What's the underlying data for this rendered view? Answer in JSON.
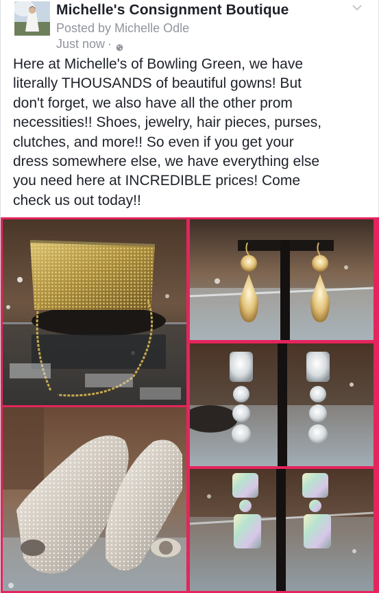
{
  "post": {
    "page_name": "Michelle's Consignment Boutique",
    "posted_by": "Posted by Michelle Odle",
    "timestamp": "Just now",
    "separator": "·",
    "message_lines": [
      "Here at Michelle's of Bowling Green, we have",
      "literally THOUSANDS of beautiful gowns! But",
      "don't forget, we also have all the other prom",
      "necessities!! Shoes, jewelry, hair pieces, purses,",
      "clutches, and more!! So even if you get your",
      "dress somewhere else, we have everything else",
      "you need here at INCREDIBLE prices! Come",
      "check us out today!!"
    ]
  },
  "icons": {
    "avatar": "profile-photo",
    "audience": "globe-icon",
    "menu": "chevron-down-icon"
  },
  "colors": {
    "collage_border": "#e5245d",
    "name_text": "#1d2129",
    "meta_text": "#90949c"
  },
  "photos": [
    {
      "subject": "gold-sequin-clutch"
    },
    {
      "subject": "gold-crystal-drop-earrings"
    },
    {
      "subject": "clear-crystal-earrings"
    },
    {
      "subject": "rhinestone-peep-toe-heels"
    },
    {
      "subject": "iridescent-crystal-earrings"
    }
  ]
}
